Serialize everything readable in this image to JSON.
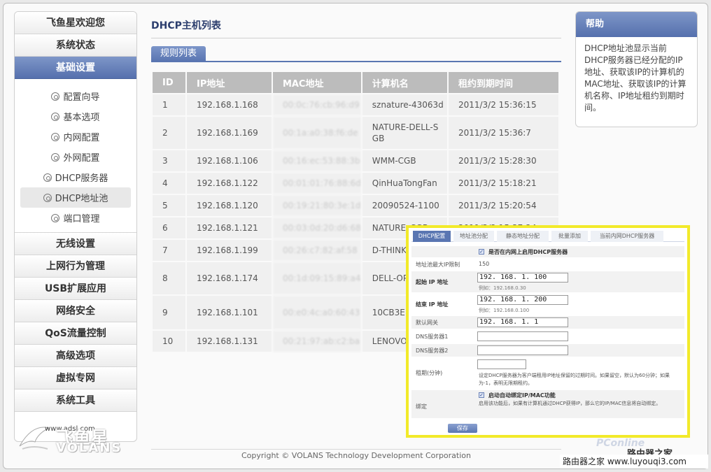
{
  "sidebar": {
    "welcome": "飞鱼星欢迎您",
    "status": "系统状态",
    "basic": "基础设置",
    "sub_items": [
      {
        "label": "配置向导"
      },
      {
        "label": "基本选项"
      },
      {
        "label": "内网配置"
      },
      {
        "label": "外网配置"
      },
      {
        "label": "DHCP服务器"
      },
      {
        "label": "DHCP地址池"
      },
      {
        "label": "端口管理"
      }
    ],
    "sections": [
      {
        "label": "无线设置"
      },
      {
        "label": "上网行为管理"
      },
      {
        "label": "USB扩展应用"
      },
      {
        "label": "网络安全"
      },
      {
        "label": "QoS流量控制"
      },
      {
        "label": "高级选项"
      },
      {
        "label": "虚拟专网"
      },
      {
        "label": "系统工具"
      }
    ]
  },
  "logo": {
    "cn": "飞鱼星",
    "en": "VOLANS",
    "url": "www.adsl.com"
  },
  "main": {
    "title": "DHCP主机列表",
    "tab": "规则列表",
    "columns": [
      "ID",
      "IP地址",
      "MAC地址",
      "计算机名",
      "租约到期时间"
    ],
    "rows": [
      {
        "id": "1",
        "ip": "192.168.1.168",
        "mac": "00:0c:76:cb:96:d9",
        "name": "sznature-43063d",
        "lease": "2011/3/2 15:36:15"
      },
      {
        "id": "2",
        "ip": "192.168.1.169",
        "mac": "00:1a:a0:38:f6:de",
        "name": "NATURE-DELL-SGB",
        "lease": "2011/3/2 15:36:7"
      },
      {
        "id": "3",
        "ip": "192.168.1.106",
        "mac": "00:16:ec:53:88:3b",
        "name": "WMM-CGB",
        "lease": "2011/3/2 15:28:30"
      },
      {
        "id": "4",
        "ip": "192.168.1.122",
        "mac": "00:01:01:76:88:6d",
        "name": "QinHuaTongFan",
        "lease": "2011/3/2 15:18:21"
      },
      {
        "id": "5",
        "ip": "192.168.1.120",
        "mac": "00:19:21:80:3e:1d",
        "name": "20090524-1100",
        "lease": "2011/3/2 15:20:54"
      },
      {
        "id": "6",
        "ip": "192.168.1.121",
        "mac": "00:03:0d:20:d6:68",
        "name": "NATURE_CGB",
        "lease": "2011/3/2 15:37:24"
      },
      {
        "id": "7",
        "ip": "192.168.1.199",
        "mac": "00:26:c7:82:af:58",
        "name": "D-THINK",
        "lease": ""
      },
      {
        "id": "8",
        "ip": "192.168.1.174",
        "mac": "00:1d:09:15:89:a4",
        "name": "DELL-OP0",
        "lease": ""
      },
      {
        "id": "9",
        "ip": "192.168.1.101",
        "mac": "00:e0:4c:a0:60:43",
        "name": "10CB3EE16",
        "lease": ""
      },
      {
        "id": "10",
        "ip": "192.168.1.131",
        "mac": "00:21:97:ab:c2:ba",
        "name": "LENOVO",
        "lease": ""
      }
    ],
    "footer": "Copyright © VOLANS Technology Development Corporation"
  },
  "help": {
    "title": "帮助",
    "text": "DHCP地址池显示当前DHCP服务器已经分配的IP地址、获取该IP的计算机的MAC地址、获取该IP的计算机名称、IP地址租约到期时间。"
  },
  "overlay": {
    "tabs": [
      "DHCP配置",
      "地址池分配",
      "静态地址分配",
      "批量添加",
      "当前内网DHCP服务器"
    ],
    "enable_label": "是否在内网上启用DHCP服务器",
    "max_label": "地址池最大IP限制",
    "max_value": "150",
    "start_label": "起始 IP 地址",
    "start_value": "192. 168. 1. 100",
    "start_hint": "例如：192.168.0.30",
    "end_label": "结束 IP 地址",
    "end_value": "192. 168. 1. 200",
    "end_hint": "例如：192.168.0.100",
    "gateway_label": "默认网关",
    "gateway_value": "192. 168. 1. 1",
    "dns1_label": "DNS服务器1",
    "dns2_label": "DNS服务器2",
    "lease_label": "租期(分钟)",
    "lease_desc": "设定DHCP服务器为客户端租用IP地址保留的过期时间。如果留空，默认为60分钟；如果为-1，表明无限期租约。",
    "bind_label": "绑定",
    "bind_check_label": "启动自动绑定IP/MAC功能",
    "bind_desc": "启用该功能后，如果有计算机通过DHCP获得IP，那么它的IP/MAC信息将自动绑定。",
    "save": "保存"
  },
  "watermark": {
    "site": "路由器之家 www.luyouqi3.com",
    "brand": "PConline",
    "brand2": "路由器之家"
  }
}
